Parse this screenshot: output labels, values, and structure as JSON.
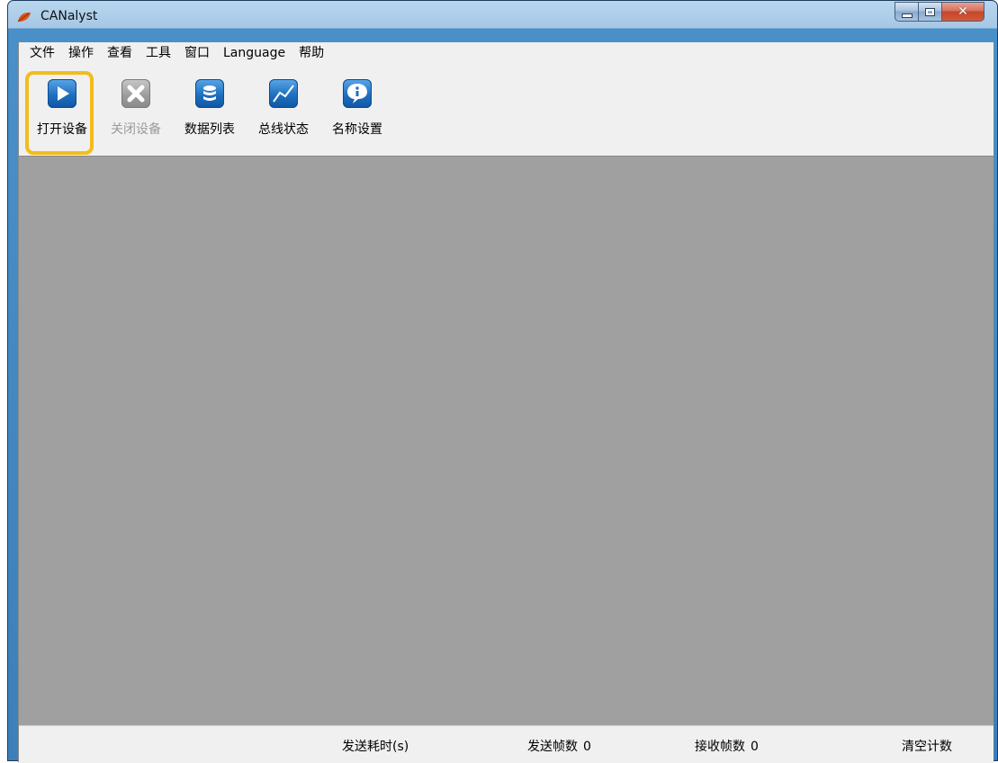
{
  "window": {
    "title": "CANalyst"
  },
  "menu": [
    "文件",
    "操作",
    "查看",
    "工具",
    "窗口",
    "Language",
    "帮助"
  ],
  "toolbar": {
    "open_device": "打开设备",
    "close_device": "关闭设备",
    "data_list": "数据列表",
    "bus_status": "总线状态",
    "name_settings": "名称设置"
  },
  "status": {
    "send_time_label": "发送耗时(s)",
    "send_frames_label": "发送帧数",
    "send_frames_value": "0",
    "recv_frames_label": "接收帧数",
    "recv_frames_value": "0",
    "clear_count": "清空计数"
  },
  "colors": {
    "highlight": "#f2bd1c",
    "workspace": "#a0a0a0",
    "icon_blue": "#1f6fc0"
  }
}
